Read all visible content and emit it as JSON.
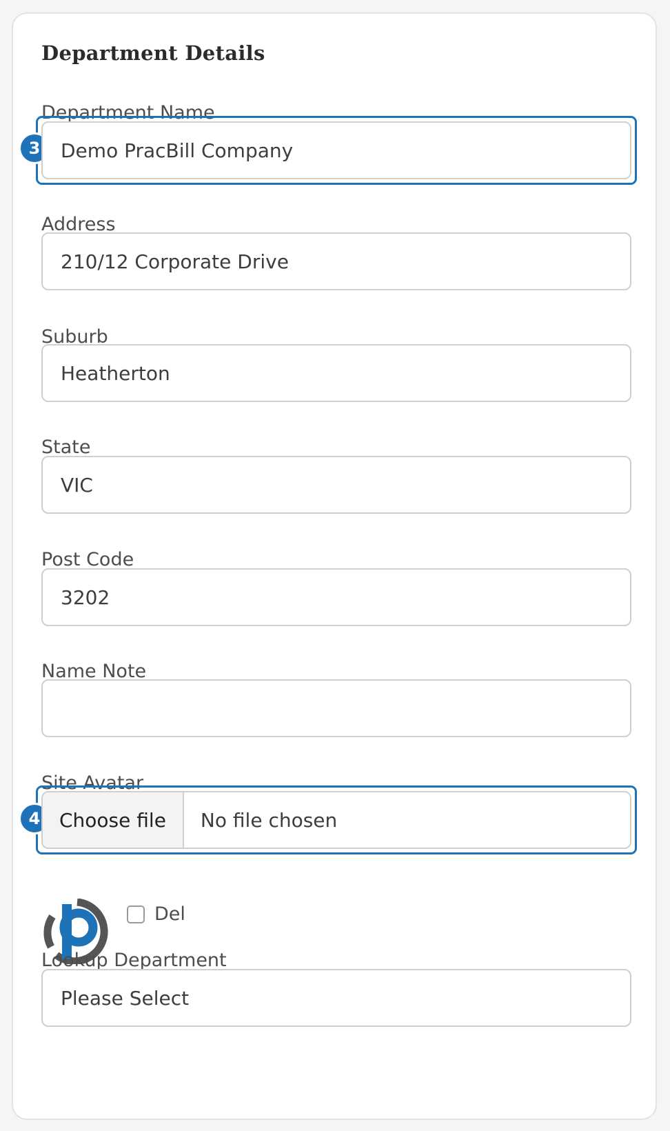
{
  "card": {
    "title": "Department Details"
  },
  "fields": {
    "department_name": {
      "label": "Department Name",
      "value": "Demo PracBill Company"
    },
    "address": {
      "label": "Address",
      "value": "210/12 Corporate Drive"
    },
    "suburb": {
      "label": "Suburb",
      "value": "Heatherton"
    },
    "state": {
      "label": "State",
      "value": "VIC"
    },
    "post_code": {
      "label": "Post Code",
      "value": "3202"
    },
    "name_note": {
      "label": "Name Note",
      "value": ""
    },
    "site_avatar": {
      "label": "Site Avatar",
      "button_label": "Choose file",
      "status": "No file chosen",
      "avatar_icon": "pracbill-logo-icon",
      "delete_label": "Del",
      "delete_checked": false
    },
    "lookup_department": {
      "label": "Lookup Department",
      "value": "Please Select"
    }
  },
  "step_badges": [
    "3",
    "4"
  ],
  "colors": {
    "accent": "#1d72b8",
    "logo_grey": "#555555",
    "logo_blue": "#1d72b8"
  }
}
